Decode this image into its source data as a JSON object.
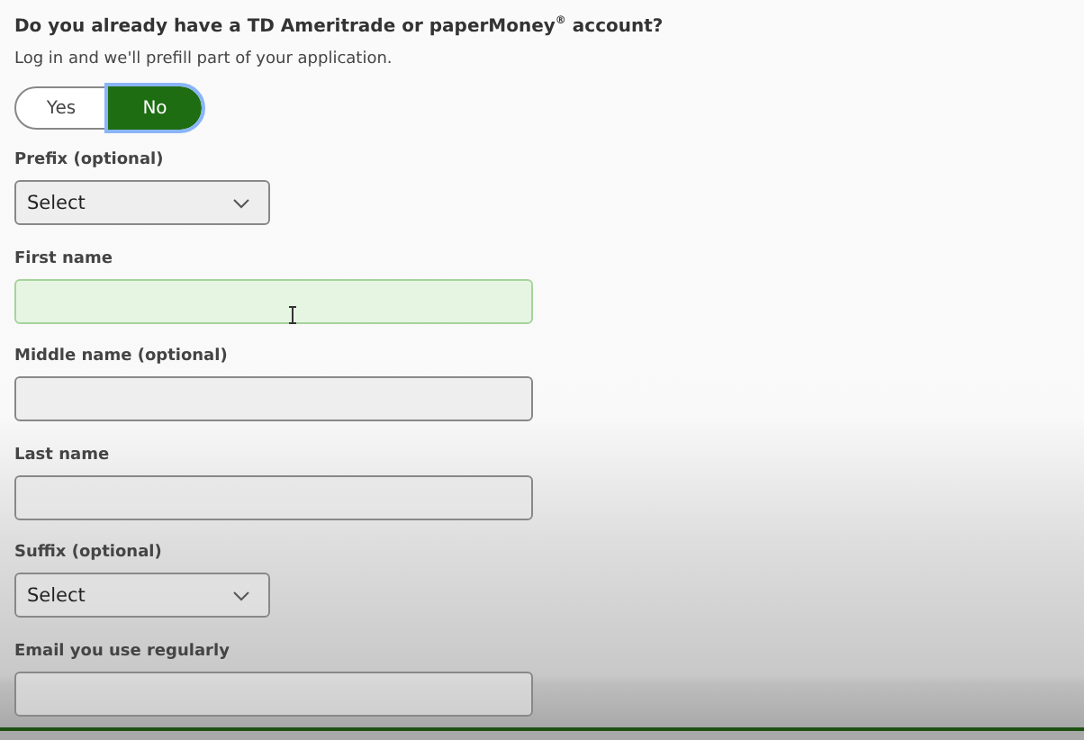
{
  "question": {
    "title": "Do you already have a TD Ameritrade or paperMoney$^{®}$ account?",
    "subtitle": "Log in and we'll prefill part of your application."
  },
  "toggle": [
    {
      "label": "Yes",
      "selected": false
    },
    {
      "label": "No",
      "selected": true
    }
  ],
  "fields": [
    {
      "kind": "select",
      "label": "Prefix (optional)",
      "value": "Select",
      "focused": false
    },
    {
      "kind": "text",
      "label": "First name",
      "focused": true
    },
    {
      "kind": "text",
      "label": "Middle name (optional)",
      "focused": false
    },
    {
      "kind": "text",
      "label": "Last name",
      "focused": false
    },
    {
      "kind": "select",
      "label": "Suffix (optional)",
      "value": "Select",
      "focused": false
    },
    {
      "kind": "text",
      "label": "Email you use regularly",
      "focused": false
    }
  ]
}
